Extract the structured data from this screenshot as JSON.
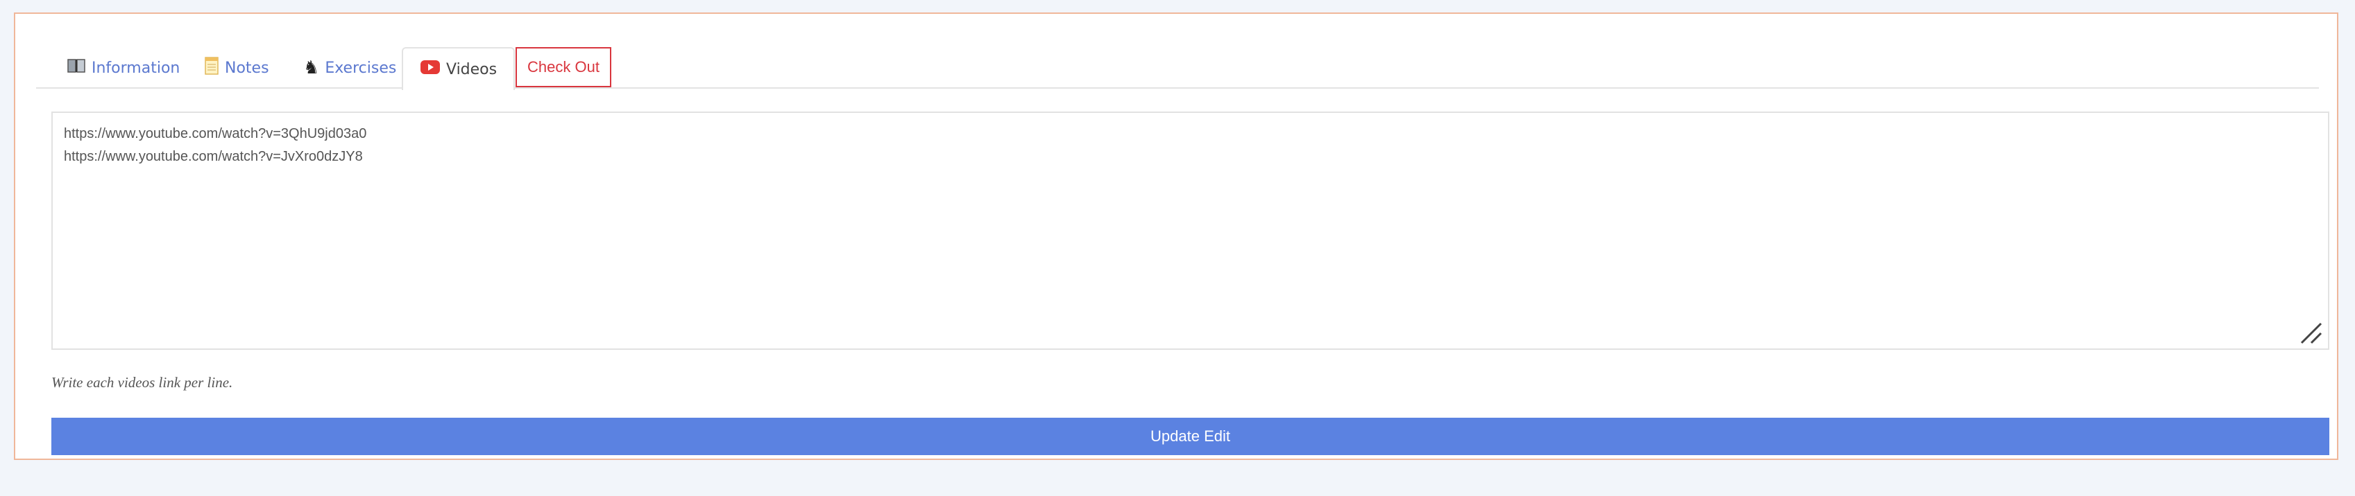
{
  "tabs": {
    "information": {
      "label": "Information",
      "icon": "book-icon"
    },
    "notes": {
      "label": "Notes",
      "icon": "notepad-icon"
    },
    "exercises": {
      "label": "Exercises",
      "icon": "chess-knight-icon"
    },
    "videos": {
      "label": "Videos",
      "icon": "youtube-icon",
      "active": true
    },
    "checkout": {
      "label": "Check Out"
    }
  },
  "videos_field": {
    "lines": [
      "https://www.youtube.com/watch?v=3QhU9jd03a0",
      "https://www.youtube.com/watch?v=JvXro0dzJY8"
    ]
  },
  "hint": "Write each videos link per line.",
  "update_button": {
    "label": "Update Edit"
  },
  "colors": {
    "accent": "#5b82e1",
    "link": "#5b78cf",
    "danger": "#d9363e",
    "panel_border": "#f0b79a",
    "youtube": "#e53935"
  }
}
